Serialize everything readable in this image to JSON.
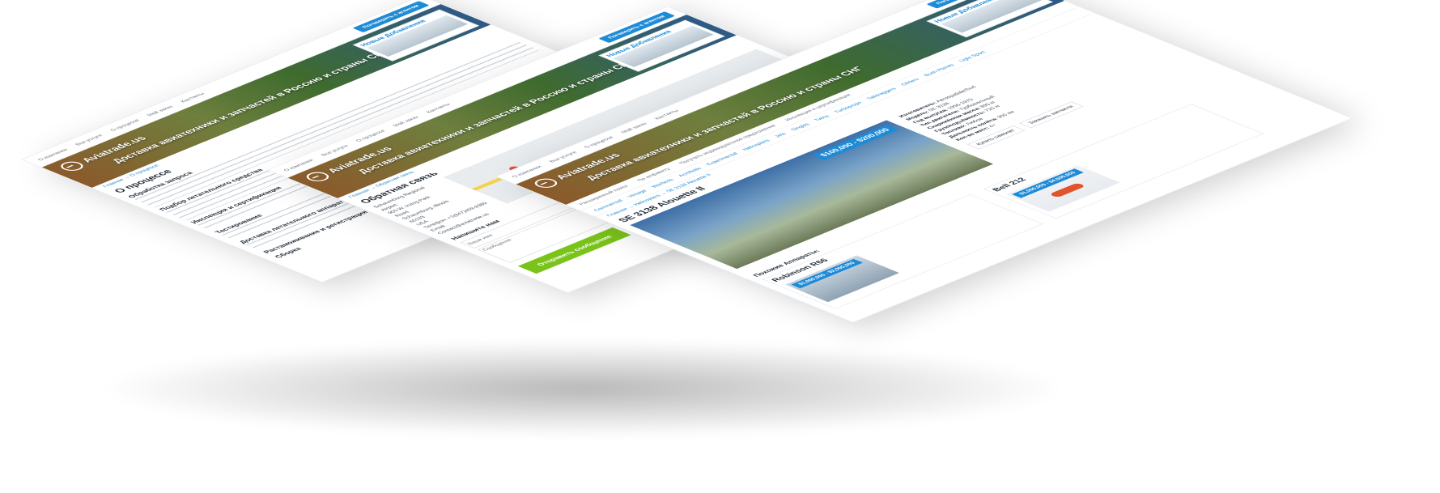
{
  "brand": {
    "logo_text": "Aviatrade.us",
    "tagline": "Доставка авиатехники и запчастей в Россию и страны СНГ"
  },
  "nav": {
    "items": [
      "О компании",
      "Все услуги",
      "О процессе",
      "Мой заказ",
      "Контакты"
    ],
    "cta": "Поговорить с агентом"
  },
  "new_additions": {
    "title": "Новые Добавления"
  },
  "page1": {
    "breadcrumb": "Главная → О процессе",
    "title": "О процессе",
    "sections": [
      "Обработка запроса",
      "Подбор летательного средства",
      "Инспекция и сертификация",
      "Тестирование",
      "Доставка летательного аппарата до клиента",
      "Растаможивание и регистрация",
      "Сборка"
    ]
  },
  "page2": {
    "breadcrumb": "Главная → Обратная связь",
    "title": "Обратная связь",
    "address": [
      "Schaumburg Regional",
      "Airport",
      "905 W. Irving Park",
      "Road",
      "Schaumburg, Illinois",
      "60193",
      "USA"
    ],
    "phone": "Телефон: +1(847)409-8389",
    "email": "Email: Contact@aviatrade.us",
    "form_title": "Напишите нам",
    "name_placeholder": "Ваше имя",
    "message_placeholder": "Сообщение",
    "submit": "Отправить сообщение"
  },
  "page3": {
    "breadcrumb": "Главная → Helicopters → SE 3138 Alouette II",
    "title": "SE 3138 Alouette II",
    "price": "$100,000 - $200,000",
    "filters": [
      "Расширенный поиск",
      "По алфавиту",
      "Получить индивидуальное предложение",
      "Инспекция и сертификация"
    ],
    "categories": [
      "Commercial",
      "Vintage",
      "Warbirds",
      "Acrobatic",
      "Experimental",
      "Helicopters",
      "Jets",
      "Singles",
      "Twins",
      "Turboprops",
      "Taildraggers",
      "Gliders",
      "Bush Planes",
      "Light Sport"
    ],
    "specs": [
      {
        "k": "Изготовитель:",
        "v": "Aerospatiale/Sud"
      },
      {
        "k": "Модель:",
        "v": "SE 3138"
      },
      {
        "k": "Год выпуска:",
        "v": "1956-1975"
      },
      {
        "k": "Тип двигателя:",
        "v": "Турбовальный"
      },
      {
        "k": "Снаряжённая масса:",
        "v": "895 кг"
      },
      {
        "k": "Грузоподъёмность:",
        "v": "720 кг"
      },
      {
        "k": "Топливо:",
        "v": "Любое"
      },
      {
        "k": "Дальность полёта:",
        "v": "300 км"
      },
      {
        "k": "Кол-во мест:",
        "v": "4+"
      }
    ],
    "buy_button": "Купить самолет",
    "order_button": "Заказать запчасти",
    "similar_title": "Похожие Аппараты:",
    "similar": [
      {
        "name": "Robinson R66",
        "price": "$1,000,000 - $2,000,000"
      },
      {
        "name": "Bell 212",
        "price": "$1,000,000 - $4,500,000"
      }
    ]
  }
}
